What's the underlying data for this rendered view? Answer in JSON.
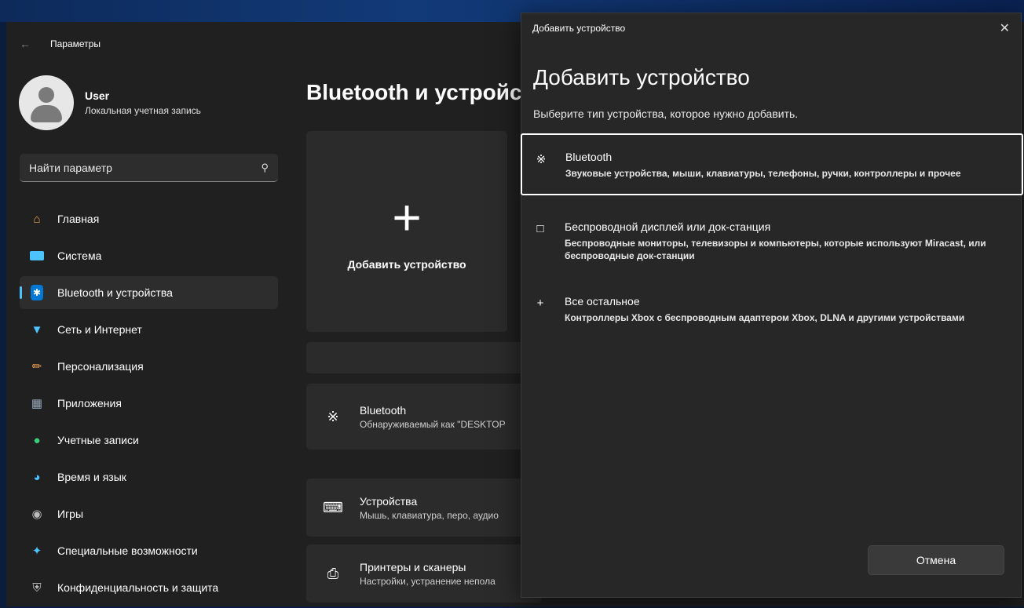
{
  "app": {
    "title": "Параметры"
  },
  "profile": {
    "name": "User",
    "account_type": "Локальная учетная запись"
  },
  "search": {
    "placeholder": "Найти параметр"
  },
  "nav": {
    "items": [
      {
        "label": "Главная",
        "icon": "home-icon",
        "color": "#f0a050"
      },
      {
        "label": "Система",
        "icon": "system-icon",
        "color": "#4cc2ff"
      },
      {
        "label": "Bluetooth и устройства",
        "icon": "bluetooth-icon",
        "color": "#0078d4",
        "selected": true
      },
      {
        "label": "Сеть и Интернет",
        "icon": "network-icon",
        "color": "#4cc2ff"
      },
      {
        "label": "Персонализация",
        "icon": "brush-icon",
        "color": "#f0a050"
      },
      {
        "label": "Приложения",
        "icon": "apps-icon",
        "color": "#9ab"
      },
      {
        "label": "Учетные записи",
        "icon": "accounts-icon",
        "color": "#3ad07a"
      },
      {
        "label": "Время и язык",
        "icon": "globe-icon",
        "color": "#4cc2ff"
      },
      {
        "label": "Игры",
        "icon": "gamepad-icon",
        "color": "#bbb"
      },
      {
        "label": "Специальные возможности",
        "icon": "accessibility-icon",
        "color": "#4cc2ff"
      },
      {
        "label": "Конфиденциальность и защита",
        "icon": "shield-icon",
        "color": "#bbb"
      }
    ]
  },
  "page": {
    "title": "Bluetooth и устройства"
  },
  "add_card": {
    "label": "Добавить устройство"
  },
  "rows": [
    {
      "title": "Bluetooth",
      "subtitle": "Обнаруживаемый как \"DESKTOP",
      "icon": "bluetooth-icon"
    },
    {
      "title": "Устройства",
      "subtitle": "Мышь, клавиатура, перо, аудио",
      "icon": "keyboard-icon"
    },
    {
      "title": "Принтеры и сканеры",
      "subtitle": "Настройки, устранение непола",
      "icon": "printer-icon"
    }
  ],
  "dialog": {
    "titlebar": "Добавить устройство",
    "heading": "Добавить устройство",
    "subtitle": "Выберите тип устройства, которое нужно добавить.",
    "options": [
      {
        "title": "Bluetooth",
        "desc": "Звуковые устройства, мыши, клавиатуры, телефоны, ручки, контроллеры и прочее",
        "icon": "bluetooth-icon",
        "focused": true
      },
      {
        "title": "Беспроводной дисплей или док-станция",
        "desc": "Беспроводные мониторы, телевизоры и компьютеры, которые используют Miracast, или беспроводные док-станции",
        "icon": "monitor-icon"
      },
      {
        "title": "Все остальное",
        "desc": "Контроллеры Xbox с беспроводным адаптером Xbox, DLNA и другими устройствами",
        "icon": "plus-icon"
      }
    ],
    "cancel_label": "Отмена"
  }
}
